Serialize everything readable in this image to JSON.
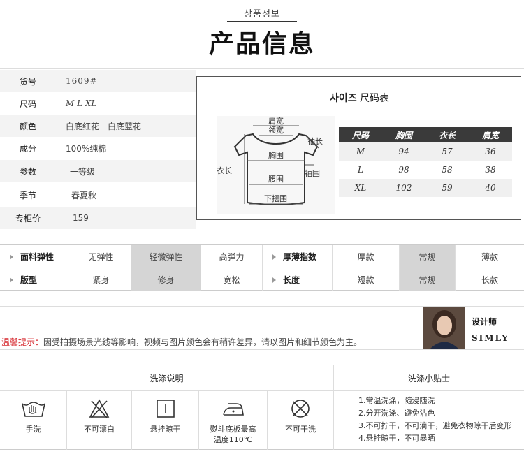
{
  "header": {
    "subtitle": "상품정보",
    "title": "产品信息"
  },
  "info": {
    "rows": [
      {
        "label": "货号",
        "value": "1609#"
      },
      {
        "label": "尺码",
        "value": "M L XL"
      },
      {
        "label": "颜色",
        "value": "白底红花　白底蓝花"
      },
      {
        "label": "成分",
        "value": "100%纯棉"
      },
      {
        "label": "参数",
        "value": "一等级"
      },
      {
        "label": "季节",
        "value": "春夏秋"
      },
      {
        "label": "专柜价",
        "value": "159"
      }
    ]
  },
  "size_chart": {
    "title_kr": "사이즈",
    "title_cn": "尺码表",
    "diagram_labels": {
      "shoulder": "肩宽",
      "collar": "领宽",
      "sleeve_length": "袖长",
      "chest": "胸围",
      "length": "衣长",
      "sleeve_width": "袖围",
      "waist": "腰围",
      "hem": "下摆围"
    },
    "headers": [
      "尺码",
      "胸围",
      "衣长",
      "肩宽"
    ],
    "rows": [
      [
        "M",
        "94",
        "57",
        "36"
      ],
      [
        "L",
        "98",
        "58",
        "38"
      ],
      [
        "XL",
        "102",
        "59",
        "40"
      ]
    ]
  },
  "attributes": {
    "elasticity_label": "面料弹性",
    "elasticity_options": [
      "无弹性",
      "轻微弹性",
      "高弹力"
    ],
    "elasticity_selected": "轻微弹性",
    "thickness_label": "厚薄指数",
    "thickness_options": [
      "厚款",
      "常规",
      "薄款"
    ],
    "thickness_selected": "常规",
    "fit_label": "版型",
    "fit_options": [
      "紧身",
      "修身",
      "宽松"
    ],
    "fit_selected": "修身",
    "length_label": "长度",
    "length_options": [
      "短款",
      "常规",
      "长款"
    ],
    "length_selected": "常规"
  },
  "tip": {
    "label": "温馨提示：",
    "text": "因受拍摄场景光线等影响，视频与图片颜色会有稍许差异，请以图片和细节颜色为主。"
  },
  "designer": {
    "title": "设计师",
    "name": "SIMLY"
  },
  "washing": {
    "header_left": "洗涤说明",
    "header_right": "洗涤小贴士",
    "items": [
      {
        "icon": "hand-wash-icon",
        "label": "手洗"
      },
      {
        "icon": "no-bleach-icon",
        "label": "不可漂白"
      },
      {
        "icon": "hang-dry-icon",
        "label": "悬挂晾干"
      },
      {
        "icon": "iron-icon",
        "label": "熨斗底板最高",
        "label2": "温度110℃"
      },
      {
        "icon": "no-dry-clean-icon",
        "label": "不可干洗"
      }
    ],
    "tips": [
      "1.常温洗涤，随浸随洗",
      "2.分开洗涤、避免沾色",
      "3.不可拧干，不可滴干，避免衣物晾干后变形",
      "4.悬挂晾干，不可暴晒"
    ]
  }
}
